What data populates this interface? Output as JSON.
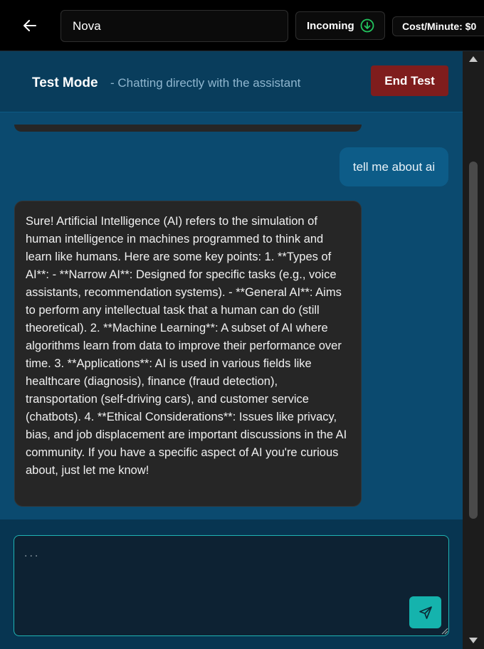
{
  "header": {
    "assistant_name": "Nova",
    "direction_label": "Incoming",
    "cost_label": "Cost/Minute:",
    "cost_value": "$0"
  },
  "test_mode": {
    "title": "Test Mode",
    "subtitle": "- Chatting directly with the assistant",
    "end_button": "End Test"
  },
  "messages": [
    {
      "role": "user",
      "text": "tell me about ai"
    },
    {
      "role": "assistant",
      "text": "Sure! Artificial Intelligence (AI) refers to the simulation of human intelligence in machines programmed to think and learn like humans. Here are some key points: 1. **Types of AI**: - **Narrow AI**: Designed for specific tasks (e.g., voice assistants, recommendation systems). - **General AI**: Aims to perform any intellectual task that a human can do (still theoretical). 2. **Machine Learning**: A subset of AI where algorithms learn from data to improve their performance over time. 3. **Applications**: AI is used in various fields like healthcare (diagnosis), finance (fraud detection), transportation (self-driving cars), and customer service (chatbots). 4. **Ethical Considerations**: Issues like privacy, bias, and job displacement are important discussions in the AI community. If you have a specific aspect of AI you're curious about, just let me know!"
    }
  ],
  "composer": {
    "placeholder": "...",
    "value": ""
  },
  "icons": {
    "back": "arrow-left-icon",
    "incoming": "arrow-down-circle-icon",
    "send": "send-icon"
  },
  "colors": {
    "accent": "#15b3ad",
    "end_button": "#7f1d1d",
    "incoming_icon": "#22c55e",
    "panel": "#0b4a6f"
  }
}
